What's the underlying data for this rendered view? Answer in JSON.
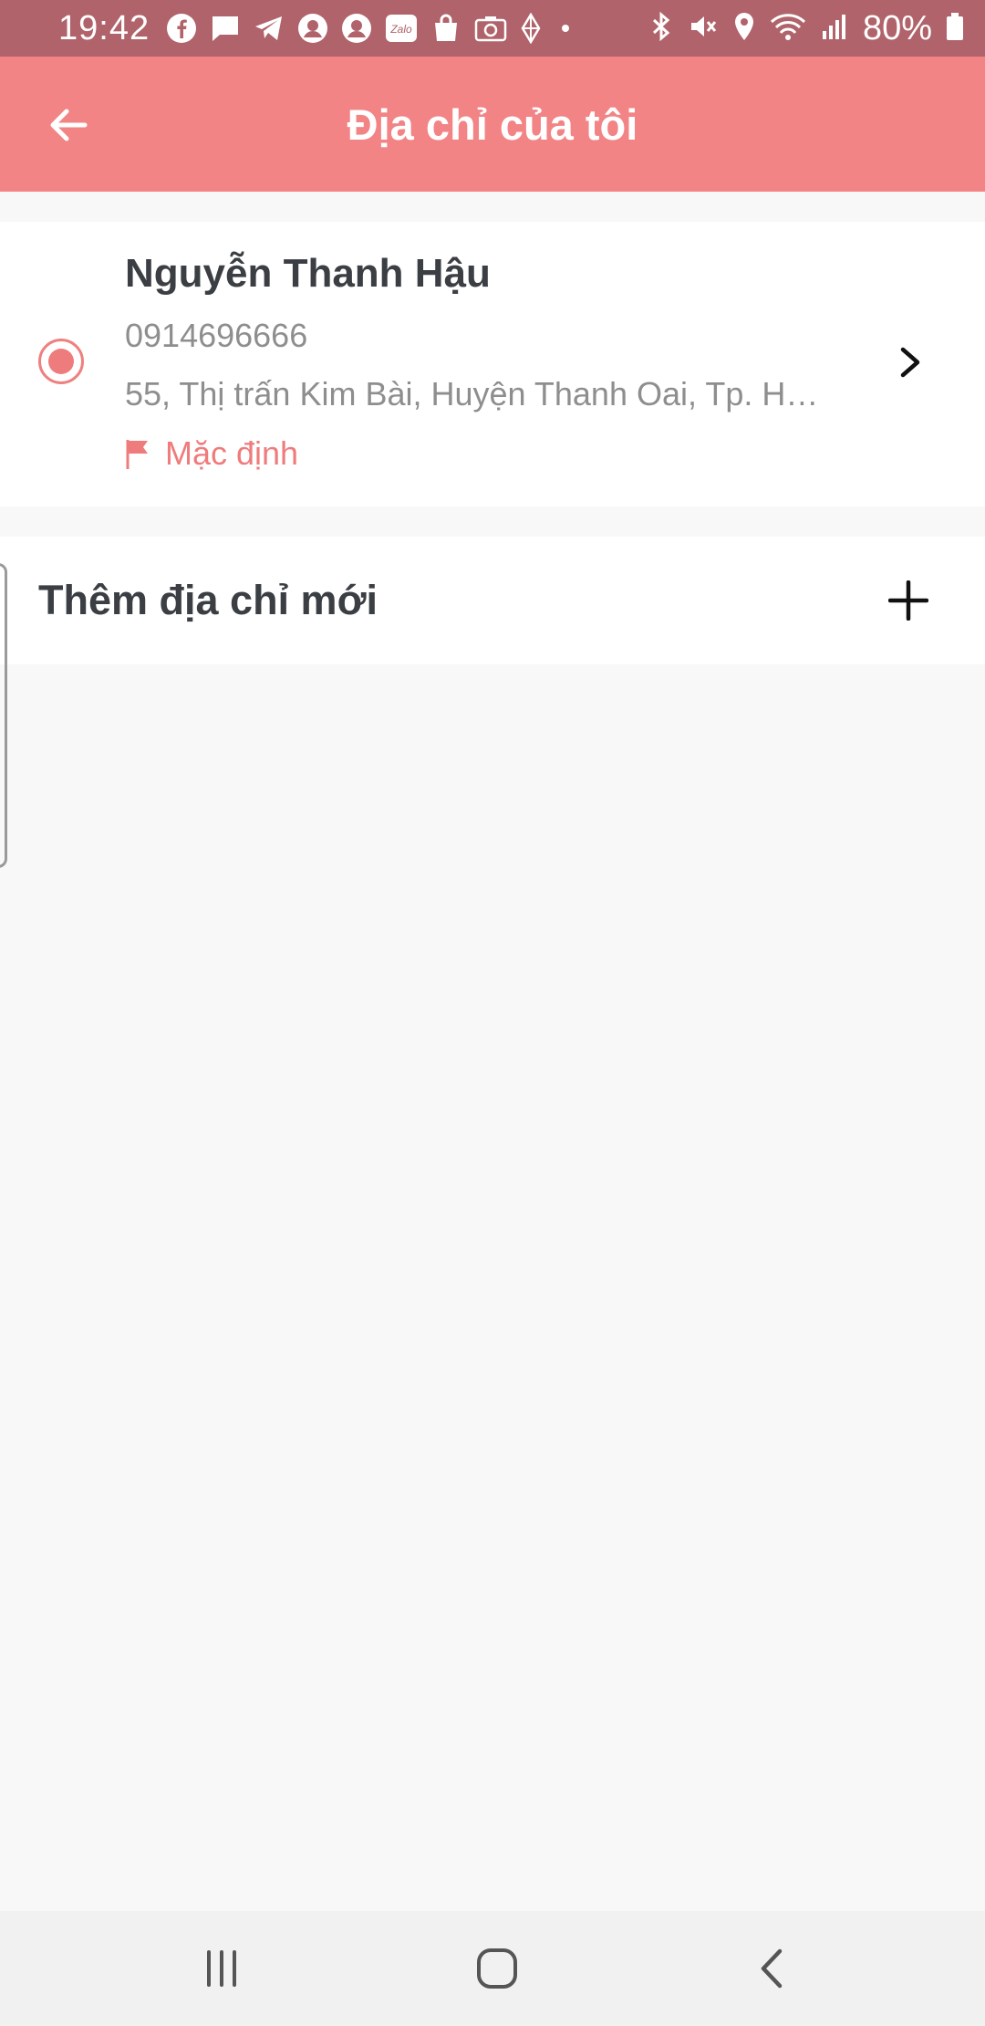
{
  "status_bar": {
    "time": "19:42",
    "battery": "80%",
    "notification_icons": [
      "facebook-icon",
      "message-icon",
      "telegram-icon",
      "face-icon",
      "face-icon",
      "zalo-icon",
      "shopping-bag-icon",
      "camera-icon",
      "diamond-icon",
      "dot-icon"
    ],
    "system_icons": [
      "bluetooth-icon",
      "mute-icon",
      "location-icon",
      "wifi-icon",
      "signal-icon",
      "battery-icon"
    ],
    "zalo_label": "Zalo"
  },
  "app_bar": {
    "title": "Địa chỉ của tôi",
    "back_icon": "arrow-left-icon"
  },
  "address": {
    "name": "Nguyễn Thanh Hậu",
    "phone": "0914696666",
    "line": "55, Thị trấn Kim Bài, Huyện Thanh Oai, Tp. H…",
    "default_label": "Mặc định",
    "selected": true
  },
  "add_address": {
    "label": "Thêm địa chỉ mới",
    "icon": "plus-icon"
  },
  "colors": {
    "accent": "#f28486",
    "status_bar": "#b0636a",
    "text_primary": "#3b3f44",
    "text_secondary": "#8e8e8e"
  },
  "nav_bar": {
    "buttons": [
      "recents-icon",
      "home-icon",
      "back-icon"
    ]
  }
}
